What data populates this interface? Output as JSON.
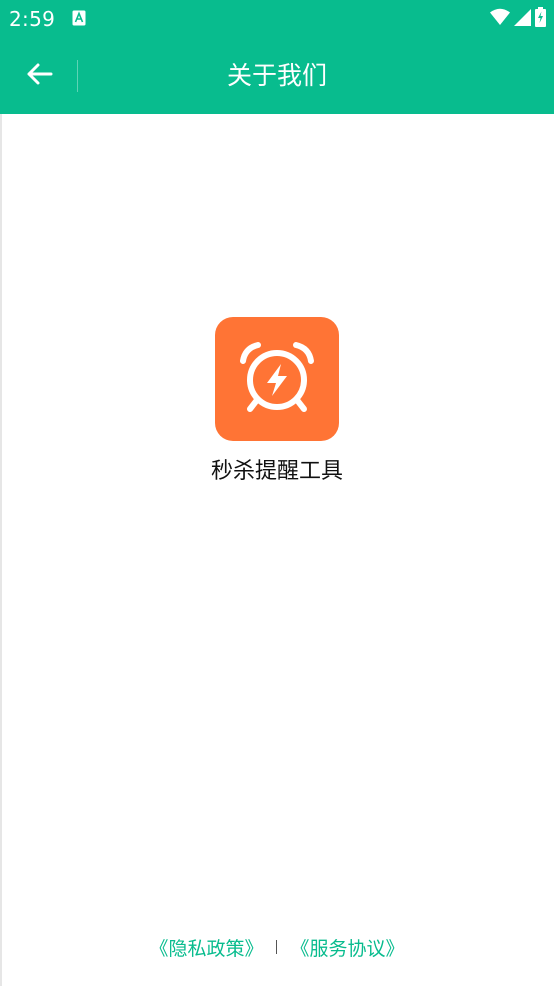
{
  "status_bar": {
    "time": "2:59",
    "notification_icon": "accessibility-app-icon",
    "icons": [
      "wifi-icon",
      "cellular-signal-icon",
      "battery-charging-icon"
    ]
  },
  "app_bar": {
    "title": "关于我们",
    "back_icon": "arrow-left-icon"
  },
  "main": {
    "app_icon": "alarm-clock-lightning-icon",
    "app_name": "秒杀提醒工具"
  },
  "footer": {
    "privacy_policy": "《隐私政策》",
    "service_agreement": "《服务协议》"
  },
  "colors": {
    "primary": "#08bc8e",
    "logo_background": "#ff7435",
    "text": "#111111",
    "background": "#ffffff"
  }
}
